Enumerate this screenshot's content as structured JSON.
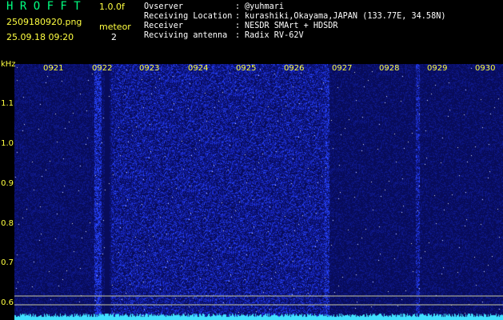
{
  "header": {
    "title": "H R O F F T",
    "version": "1.0.0f",
    "filename": "2509180920.png",
    "datetime": "25.09.18 09:20",
    "meteor_label": "meteor",
    "meteor_count": "2"
  },
  "info": [
    {
      "key": "Ovserver",
      "sep": ":",
      "value": "@yuhmari"
    },
    {
      "key": "Receiving Location",
      "sep": ":",
      "value": "kurashiki,Okayama,JAPAN (133.77E, 34.58N)"
    },
    {
      "key": "Receiver",
      "sep": ":",
      "value": "NESDR SMArt + HDSDR"
    },
    {
      "key": "Recviving antenna",
      "sep": ":",
      "value": "Radix RV-62V"
    }
  ],
  "axis": {
    "y_unit": "kHz",
    "y_ticks": [
      "1.1",
      "1.0",
      "0.9",
      "0.8",
      "0.7",
      "0.6"
    ],
    "x_ticks": [
      "0921",
      "0922",
      "0923",
      "0924",
      "0925",
      "0926",
      "0927",
      "0928",
      "0929",
      "0930"
    ]
  },
  "colors": {
    "background": "#000000",
    "label_yellow": "#ffff40",
    "title_green": "#00ff80",
    "spectrum_base": "#0a0f5a",
    "signal_cyan": "#40e0ff"
  }
}
